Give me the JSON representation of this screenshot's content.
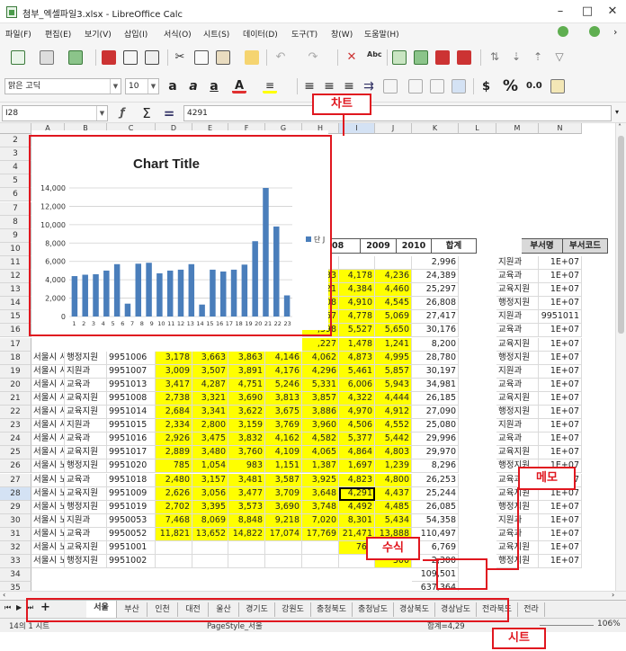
{
  "window": {
    "title": "첨부_엑셀파일3.xlsx - LibreOffice Calc",
    "minimize": "–",
    "maximize": "□",
    "close": "✕"
  },
  "menu": [
    "파일(F)",
    "편집(E)",
    "보기(V)",
    "삽입(I)",
    "서식(O)",
    "시트(S)",
    "데이터(D)",
    "도구(T)",
    "창(W)",
    "도움말(H)"
  ],
  "format": {
    "font_name": "맑은 고딕",
    "font_size": "10",
    "currency": "$",
    "percent": "%",
    "decimal": "0.0"
  },
  "formula_bar": {
    "cell_ref": "I28",
    "content": "4291"
  },
  "column_headers": [
    "A",
    "B",
    "C",
    "D",
    "E",
    "F",
    "G",
    "H",
    "I",
    "J",
    "K",
    "L",
    "M",
    "N"
  ],
  "row_numbers": [
    "2",
    "3",
    "4",
    "5",
    "6",
    "7",
    "8",
    "9",
    "10",
    "11",
    "12",
    "13",
    "14",
    "15",
    "16",
    "17",
    "18",
    "19",
    "20",
    "21",
    "22",
    "23",
    "24",
    "25",
    "26",
    "27",
    "28",
    "29",
    "30",
    "31",
    "32",
    "33",
    "34",
    "35"
  ],
  "visible_headers": {
    "h2009": "2009",
    "h2010": "2010",
    "total": "합계",
    "dept": "부서명",
    "code": "부서코드",
    "h_partial": "08"
  },
  "upper_rows": [
    {
      "row": "11",
      "h": "",
      "i": "",
      "j": "",
      "k": "2,996",
      "m": "지원과",
      "n": "1E+07"
    },
    {
      "row": "12",
      "h": ",483",
      "i": "4,178",
      "j": "4,236",
      "k": "24,389",
      "m": "교육과",
      "n": "1E+07"
    },
    {
      "row": "13",
      "h": ",721",
      "i": "4,384",
      "j": "4,460",
      "k": "25,297",
      "m": "교육지원",
      "n": "1E+07"
    },
    {
      "row": "14",
      "h": ",208",
      "i": "4,910",
      "j": "4,545",
      "k": "26,808",
      "m": "행정지원",
      "n": "1E+07"
    },
    {
      "row": "15",
      "h": ",267",
      "i": "4,778",
      "j": "5,069",
      "k": "27,417",
      "m": "지원과",
      "n": "9951011"
    },
    {
      "row": "16",
      "h": ",398",
      "i": "5,527",
      "j": "5,650",
      "k": "30,176",
      "m": "교육과",
      "n": "1E+07"
    },
    {
      "row": "17",
      "h": ",227",
      "i": "1,478",
      "j": "1,241",
      "k": "8,200",
      "m": "교육지원",
      "n": "1E+07"
    }
  ],
  "rows": [
    {
      "row": "18",
      "a": "서울시 서",
      "b": "행정지원",
      "c": "9951006",
      "d": "3,178",
      "e": "3,663",
      "f": "3,863",
      "g": "4,146",
      "h": "4,062",
      "i": "4,873",
      "j": "4,995",
      "k": "28,780",
      "m": "행정지원",
      "n": "1E+07"
    },
    {
      "row": "19",
      "a": "서울시 서",
      "b": "지원과",
      "c": "9951007",
      "d": "3,009",
      "e": "3,507",
      "f": "3,891",
      "g": "4,176",
      "h": "4,296",
      "i": "5,461",
      "j": "5,857",
      "k": "30,197",
      "m": "지원과",
      "n": "1E+07"
    },
    {
      "row": "20",
      "a": "서울시 서",
      "b": "교육과",
      "c": "9951013",
      "d": "3,417",
      "e": "4,287",
      "f": "4,751",
      "g": "5,246",
      "h": "5,331",
      "i": "6,006",
      "j": "5,943",
      "k": "34,981",
      "m": "교육과",
      "n": "1E+07"
    },
    {
      "row": "21",
      "a": "서울시 서",
      "b": "교육지원",
      "c": "9951008",
      "d": "2,738",
      "e": "3,321",
      "f": "3,690",
      "g": "3,813",
      "h": "3,857",
      "i": "4,322",
      "j": "4,444",
      "k": "26,185",
      "m": "교육지원",
      "n": "1E+07"
    },
    {
      "row": "22",
      "a": "서울시 서",
      "b": "교육지원",
      "c": "9951014",
      "d": "2,684",
      "e": "3,341",
      "f": "3,622",
      "g": "3,675",
      "h": "3,886",
      "i": "4,970",
      "j": "4,912",
      "k": "27,090",
      "m": "행정지원",
      "n": "1E+07"
    },
    {
      "row": "23",
      "a": "서울시 서",
      "b": "지원과",
      "c": "9951015",
      "d": "2,334",
      "e": "2,800",
      "f": "3,159",
      "g": "3,769",
      "h": "3,960",
      "i": "4,506",
      "j": "4,552",
      "k": "25,080",
      "m": "지원과",
      "n": "1E+07"
    },
    {
      "row": "24",
      "a": "서울시 서",
      "b": "교육과",
      "c": "9951016",
      "d": "2,926",
      "e": "3,475",
      "f": "3,832",
      "g": "4,162",
      "h": "4,582",
      "i": "5,377",
      "j": "5,442",
      "k": "29,996",
      "m": "교육과",
      "n": "1E+07"
    },
    {
      "row": "25",
      "a": "서울시 서",
      "b": "교육지원",
      "c": "9951017",
      "d": "2,889",
      "e": "3,480",
      "f": "3,760",
      "g": "4,109",
      "h": "4,065",
      "i": "4,864",
      "j": "4,803",
      "k": "29,970",
      "m": "교육지원",
      "n": "1E+07"
    },
    {
      "row": "26",
      "a": "서울시 노",
      "b": "행정지원",
      "c": "9951020",
      "d": "785",
      "e": "1,054",
      "f": "983",
      "g": "1,151",
      "h": "1,387",
      "i": "1,697",
      "j": "1,239",
      "k": "8,296",
      "m": "행정지원",
      "n": "1E+07"
    },
    {
      "row": "27",
      "a": "서울시 노",
      "b": "교육과",
      "c": "9951018",
      "d": "2,480",
      "e": "3,157",
      "f": "3,481",
      "g": "3,587",
      "h": "3,925",
      "i": "4,823",
      "j": "4,800",
      "k": "26,253",
      "m": "교육과",
      "n": "1E+07"
    },
    {
      "row": "28",
      "a": "서울시 노",
      "b": "교육지원",
      "c": "9951009",
      "d": "2,626",
      "e": "3,056",
      "f": "3,477",
      "g": "3,709",
      "h": "3,648",
      "i": "4,291",
      "j": "4,437",
      "k": "25,244",
      "m": "교육지원",
      "n": "1E+07"
    },
    {
      "row": "29",
      "a": "서울시 노",
      "b": "행정지원",
      "c": "9951019",
      "d": "2,702",
      "e": "3,395",
      "f": "3,573",
      "g": "3,690",
      "h": "3,748",
      "i": "4,492",
      "j": "4,485",
      "k": "26,085",
      "m": "행정지원",
      "n": "1E+07"
    },
    {
      "row": "30",
      "a": "서울시 노",
      "b": "지원과",
      "c": "9950053",
      "d": "7,468",
      "e": "8,069",
      "f": "8,848",
      "g": "9,218",
      "h": "7,020",
      "i": "8,301",
      "j": "5,434",
      "k": "54,358",
      "m": "지원과",
      "n": "1E+07"
    },
    {
      "row": "31",
      "a": "서울시 노",
      "b": "교육과",
      "c": "9950052",
      "d": "11,821",
      "e": "13,652",
      "f": "14,822",
      "g": "17,074",
      "h": "17,769",
      "i": "21,471",
      "j": "13,888",
      "k": "110,497",
      "m": "교육과",
      "n": "1E+07"
    },
    {
      "row": "32",
      "a": "서울시 노",
      "b": "교육지원",
      "c": "9951001",
      "d": "",
      "e": "",
      "f": "",
      "g": "",
      "h": "",
      "i": "769",
      "j": "",
      "k": "6,769",
      "m": "교육지원",
      "n": "1E+07"
    },
    {
      "row": "33",
      "a": "서울시 노",
      "b": "행정지원",
      "c": "9951002",
      "d": "",
      "e": "",
      "f": "",
      "g": "",
      "h": "",
      "i": "",
      "j": "300",
      "k": "2,300",
      "m": "행정지원",
      "n": "1E+07"
    }
  ],
  "row34_k": "109,501",
  "row35_k": "637,364",
  "chart_data": {
    "type": "bar",
    "title": "Chart Title",
    "categories": [
      "1",
      "2",
      "3",
      "4",
      "5",
      "6",
      "7",
      "8",
      "9",
      "10",
      "11",
      "12",
      "13",
      "14",
      "15",
      "16",
      "17",
      "18",
      "19",
      "20",
      "21",
      "22",
      "23"
    ],
    "series": [
      {
        "name": "단 J",
        "values": [
          4400,
          4550,
          4600,
          5000,
          5700,
          1400,
          5750,
          5850,
          4700,
          5000,
          5100,
          5700,
          1300,
          5100,
          4900,
          5100,
          5650,
          8200,
          14000,
          9800,
          2300
        ]
      }
    ],
    "ylim": [
      0,
      14000
    ],
    "yticks": [
      "0",
      "2,000",
      "4,000",
      "6,000",
      "8,000",
      "10,000",
      "12,000",
      "14,000"
    ],
    "grid": true,
    "legend": "right",
    "color": "#4a7ebb"
  },
  "annotations": {
    "chart": "차트",
    "memo": "메모",
    "formula": "수식",
    "sheet": "시트"
  },
  "sheet_tabs": [
    "서울",
    "부산",
    "인천",
    "대전",
    "울산",
    "경기도",
    "강원도",
    "충청북도",
    "충청남도",
    "경상북도",
    "경상남도",
    "전라북도",
    "전라"
  ],
  "status": {
    "sheet": "14의 1 시트",
    "style": "PageStyle_서울",
    "sum": "합계=4,29",
    "zoom": "106%"
  },
  "colors": {
    "highlight": "#ffff00",
    "annotation": "#e0171f",
    "selected_header": "#d4e2f4"
  }
}
